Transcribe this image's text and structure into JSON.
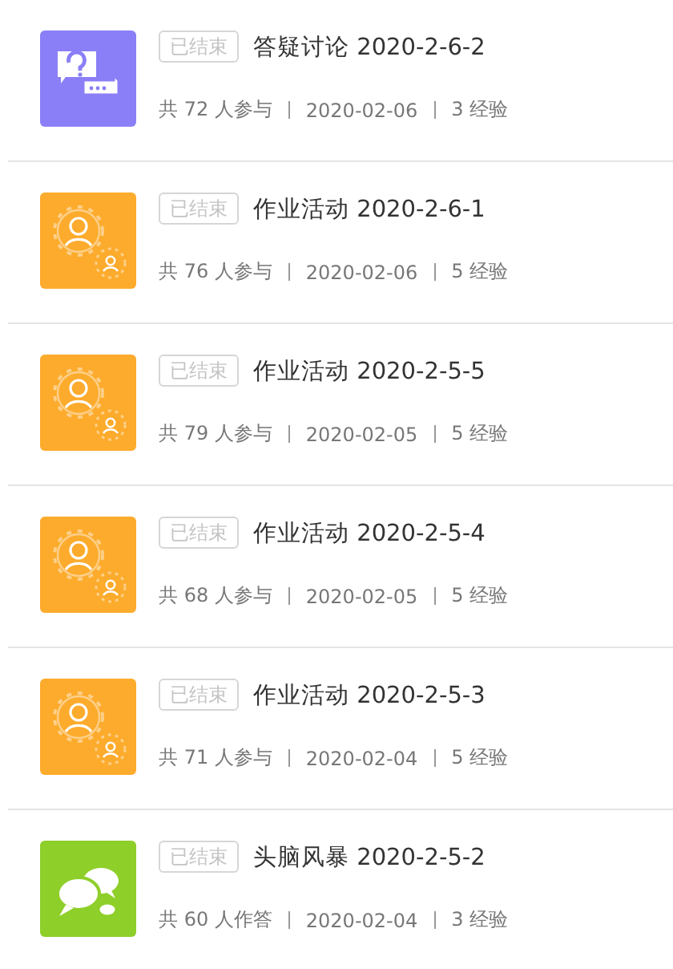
{
  "activities": [
    {
      "kind": "discussion",
      "status": "已结束",
      "title": "答疑讨论 2020-2-6-2",
      "participants": "共 72 人参与",
      "date": "2020-02-06",
      "exp": "3 经验"
    },
    {
      "kind": "homework",
      "status": "已结束",
      "title": "作业活动 2020-2-6-1",
      "participants": "共 76 人参与",
      "date": "2020-02-06",
      "exp": "5 经验"
    },
    {
      "kind": "homework",
      "status": "已结束",
      "title": "作业活动 2020-2-5-5",
      "participants": "共 79 人参与",
      "date": "2020-02-05",
      "exp": "5 经验"
    },
    {
      "kind": "homework",
      "status": "已结束",
      "title": "作业活动 2020-2-5-4",
      "participants": "共 68 人参与",
      "date": "2020-02-05",
      "exp": "5 经验"
    },
    {
      "kind": "homework",
      "status": "已结束",
      "title": "作业活动 2020-2-5-3",
      "participants": "共 71 人参与",
      "date": "2020-02-04",
      "exp": "5 经验"
    },
    {
      "kind": "brainstorm",
      "status": "已结束",
      "title": "头脑风暴 2020-2-5-2",
      "participants": "共 60 人作答",
      "date": "2020-02-04",
      "exp": "3 经验"
    }
  ]
}
